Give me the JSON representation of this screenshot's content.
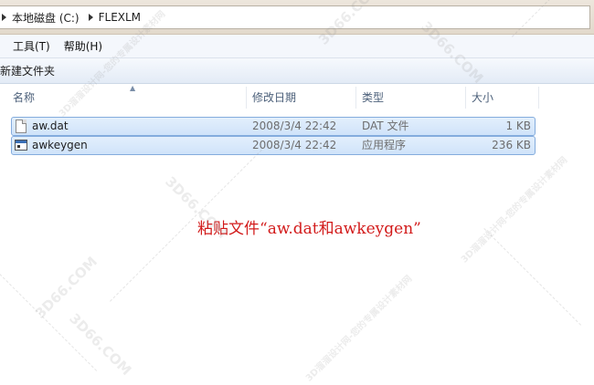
{
  "address_bar": {
    "crumbs": [
      "本地磁盘 (C:)",
      "FLEXLM"
    ]
  },
  "menu": {
    "items": [
      "工具(T)",
      "帮助(H)"
    ]
  },
  "command_bar": {
    "new_folder_label": "新建文件夹"
  },
  "columns": {
    "name": "名称",
    "date": "修改日期",
    "type": "类型",
    "size": "大小"
  },
  "files": [
    {
      "name": "aw.dat",
      "date": "2008/3/4 22:42",
      "type": "DAT 文件",
      "size": "1 KB",
      "icon": "file-icon"
    },
    {
      "name": "awkeygen",
      "date": "2008/3/4 22:42",
      "type": "应用程序",
      "size": "236 KB",
      "icon": "exe-icon"
    }
  ],
  "annotation": "粘贴文件“aw.dat和awkeygen”",
  "watermark": {
    "site": "3D66.COM",
    "slogan": "3D溜溜设计网-您的专属设计素材网"
  },
  "colors": {
    "annotation": "#d21a1a",
    "selection_border": "#84acdd"
  }
}
